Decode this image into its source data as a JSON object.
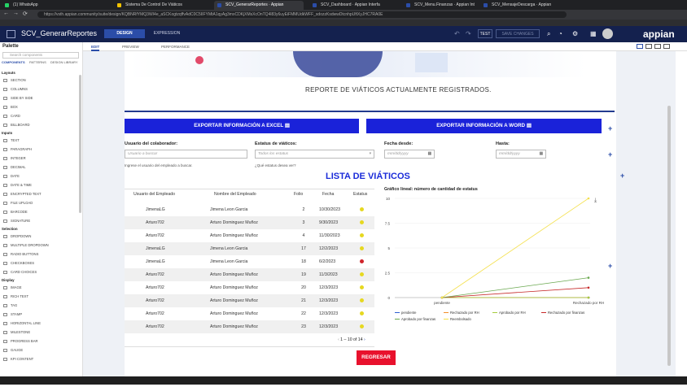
{
  "browser": {
    "tabs": [
      {
        "label": "(1) WhatsApp",
        "color": "#25d366"
      },
      {
        "label": "Sistema De Control De Viáticos",
        "color": "#f2c200"
      },
      {
        "label": "SCV_GenerarReportes · Appian",
        "color": "#2b4da8"
      },
      {
        "label": "SCV_Dashboard · Appian Interfa",
        "color": "#2b4da8"
      },
      {
        "label": "SCV_Menu.Finanzas · Appian Inte",
        "color": "#2b4da8"
      },
      {
        "label": "SCV_MensajeDescarga · Appian",
        "color": "#2b4da8"
      }
    ],
    "url": "https://vsth.appian.community/suite/design/KQBNRfYMQ3WI4e_aSCKogtzqffvAdC0C5IIFYMtA1qyAg3mxCDKjXMsXcOnTQ4l83y6uyEiFMMUdkWFF_sdozzKsdwwDtcnhpUftXyJHC7RA0E"
  },
  "app": {
    "title": "SCV_GenerarReportes",
    "design_label": "DESIGN",
    "expression_label": "EXPRESSION",
    "test_label": "TEST",
    "save_label": "SAVE CHANGES",
    "logo": "appian"
  },
  "palette": {
    "title": "Palette",
    "search_placeholder": "Search components",
    "tabs": [
      "COMPONENTS",
      "PATTERNS",
      "DESIGN LIBRARY"
    ],
    "sections": [
      {
        "name": "Layouts",
        "items": [
          "SECTION",
          "COLUMNS",
          "SIDE BY SIDE",
          "BOX",
          "CARD",
          "BILLBOARD"
        ]
      },
      {
        "name": "Inputs",
        "items": [
          "TEXT",
          "PARAGRAPH",
          "INTEGER",
          "DECIMAL",
          "DATE",
          "DATE & TIME",
          "ENCRYPTED TEXT",
          "FILE UPLOAD",
          "BARCODE",
          "SIGNATURE"
        ]
      },
      {
        "name": "Selection",
        "items": [
          "DROPDOWN",
          "MULTIPLE DROPDOWN",
          "RADIO BUTTONS",
          "CHECKBOXES",
          "CARD CHOICES"
        ]
      },
      {
        "name": "Display",
        "items": [
          "IMAGE",
          "RICH TEXT",
          "TAG",
          "STAMP",
          "HORIZONTAL LINE",
          "MILESTONE",
          "PROGRESS BAR",
          "GAUGE",
          "KPI CONTENT"
        ]
      }
    ]
  },
  "editor_tabs": [
    "EDIT",
    "PREVIEW",
    "PERFORMANCE"
  ],
  "page": {
    "report_heading": "REPORTE DE VIÁTICOS ACTUALMENTE REGISTRADOS.",
    "export_excel": "EXPORTAR INFORMACIÓN A EXCEL",
    "export_word": "EXPORTAR INFORMACIÓN A WORD",
    "user_label": "Usuario del colaborador:",
    "user_placeholder": "Usuario a buscar",
    "user_help": "Ingrese el usuario del empleado a buscar.",
    "status_label": "Estatus de viáticos:",
    "status_placeholder": "Todos los estatus",
    "status_help": "¿Qué estatus desea ver?",
    "date_from_label": "Fecha desde:",
    "date_from_placeholder": "mm/dd/yyyy",
    "date_to_label": "Hasta:",
    "date_to_placeholder": "mm/dd/yyyy",
    "list_title": "LISTA DE VIÁTICOS",
    "regresar": "REGRESAR"
  },
  "table": {
    "headers": [
      "Usuario del Empleado",
      "Nombre del Empleado",
      "Folio",
      "Fecha",
      "Estatus"
    ],
    "rows": [
      {
        "usuario": "JimenaLG",
        "nombre": "Jimena Leon Garcia",
        "folio": "2",
        "fecha": "10/30/2023",
        "status_color": "#e6d820"
      },
      {
        "usuario": "Arturo702",
        "nombre": "Arturo Dominguez Muñoz",
        "folio": "3",
        "fecha": "9/30/2023",
        "status_color": "#e6d820"
      },
      {
        "usuario": "Arturo702",
        "nombre": "Arturo Dominguez Muñoz",
        "folio": "4",
        "fecha": "11/30/2023",
        "status_color": "#e6d820"
      },
      {
        "usuario": "JimenaLG",
        "nombre": "Jimena Leon Garcia",
        "folio": "17",
        "fecha": "12/2/2023",
        "status_color": "#e6d820"
      },
      {
        "usuario": "JimenaLG",
        "nombre": "Jimena Leon Garcia",
        "folio": "18",
        "fecha": "6/2/2023",
        "status_color": "#d0242b"
      },
      {
        "usuario": "Arturo702",
        "nombre": "Arturo Dominguez Muñoz",
        "folio": "19",
        "fecha": "11/3/2023",
        "status_color": "#e6d820"
      },
      {
        "usuario": "Arturo702",
        "nombre": "Arturo Dominguez Muñoz",
        "folio": "20",
        "fecha": "12/3/2023",
        "status_color": "#e6d820"
      },
      {
        "usuario": "Arturo702",
        "nombre": "Arturo Dominguez Muñoz",
        "folio": "21",
        "fecha": "12/3/2023",
        "status_color": "#e6d820"
      },
      {
        "usuario": "Arturo702",
        "nombre": "Arturo Dominguez Muñoz",
        "folio": "22",
        "fecha": "12/3/2023",
        "status_color": "#e6d820"
      },
      {
        "usuario": "Arturo702",
        "nombre": "Arturo Dominguez Muñoz",
        "folio": "23",
        "fecha": "12/3/2023",
        "status_color": "#e6d820"
      }
    ],
    "pager": "1 – 10 of 14"
  },
  "chart_data": {
    "type": "line",
    "title": "Gráfico lineal: número de cantidad de estatus",
    "categories": [
      "pendiente",
      "Rechazado por RH"
    ],
    "ylim": [
      0,
      10
    ],
    "yticks": [
      "0",
      "2.5",
      "5",
      "7.5",
      "10"
    ],
    "series": [
      {
        "name": "pendiente",
        "color": "#2f5fd0",
        "values": [
          0,
          0
        ]
      },
      {
        "name": "Rechazado por RH",
        "color": "#f28e2b",
        "values": [
          0,
          0
        ]
      },
      {
        "name": "Aprobado por RH",
        "color": "#a6cc3f",
        "values": [
          0,
          0
        ]
      },
      {
        "name": "Rechazado por finanzas",
        "color": "#c62828",
        "values": [
          0,
          1
        ]
      },
      {
        "name": "Aprobado por finanzas",
        "color": "#6aa84f",
        "values": [
          0,
          2
        ]
      },
      {
        "name": "Reembolsado",
        "color": "#f4e04d",
        "values": [
          0,
          10
        ]
      }
    ]
  }
}
